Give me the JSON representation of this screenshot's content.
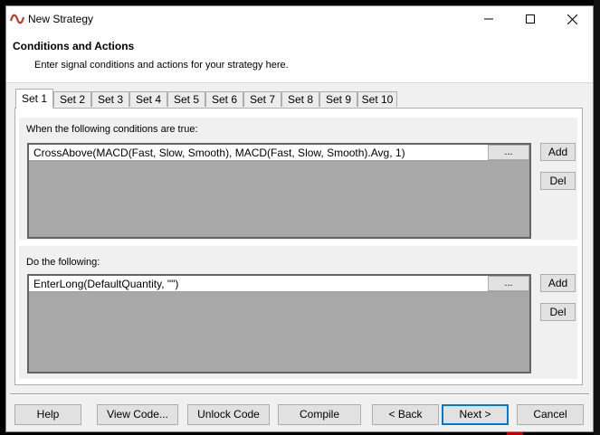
{
  "window": {
    "title": "New Strategy"
  },
  "header": {
    "title": "Conditions and Actions",
    "subtitle": "Enter signal conditions and actions for your strategy here."
  },
  "tabs": [
    {
      "label": "Set 1",
      "active": true
    },
    {
      "label": "Set 2"
    },
    {
      "label": "Set 3"
    },
    {
      "label": "Set 4"
    },
    {
      "label": "Set 5"
    },
    {
      "label": "Set 6"
    },
    {
      "label": "Set 7"
    },
    {
      "label": "Set 8"
    },
    {
      "label": "Set 9"
    },
    {
      "label": "Set 10"
    }
  ],
  "conditions": {
    "label": "When the following conditions are true:",
    "items": [
      "CrossAbove(MACD(Fast, Slow, Smooth), MACD(Fast, Slow, Smooth).Avg, 1)"
    ],
    "ellipsis_label": "...",
    "add_label": "Add",
    "del_label": "Del"
  },
  "actions": {
    "label": "Do the following:",
    "items": [
      "EnterLong(DefaultQuantity, \"\")"
    ],
    "ellipsis_label": "...",
    "add_label": "Add",
    "del_label": "Del"
  },
  "footer": {
    "help": "Help",
    "view_code": "View Code...",
    "unlock_code": "Unlock Code",
    "compile": "Compile",
    "back": "< Back",
    "next": "Next >",
    "cancel": "Cancel"
  },
  "colors": {
    "accent": "#0078d7",
    "app_icon": "#c0392b"
  }
}
